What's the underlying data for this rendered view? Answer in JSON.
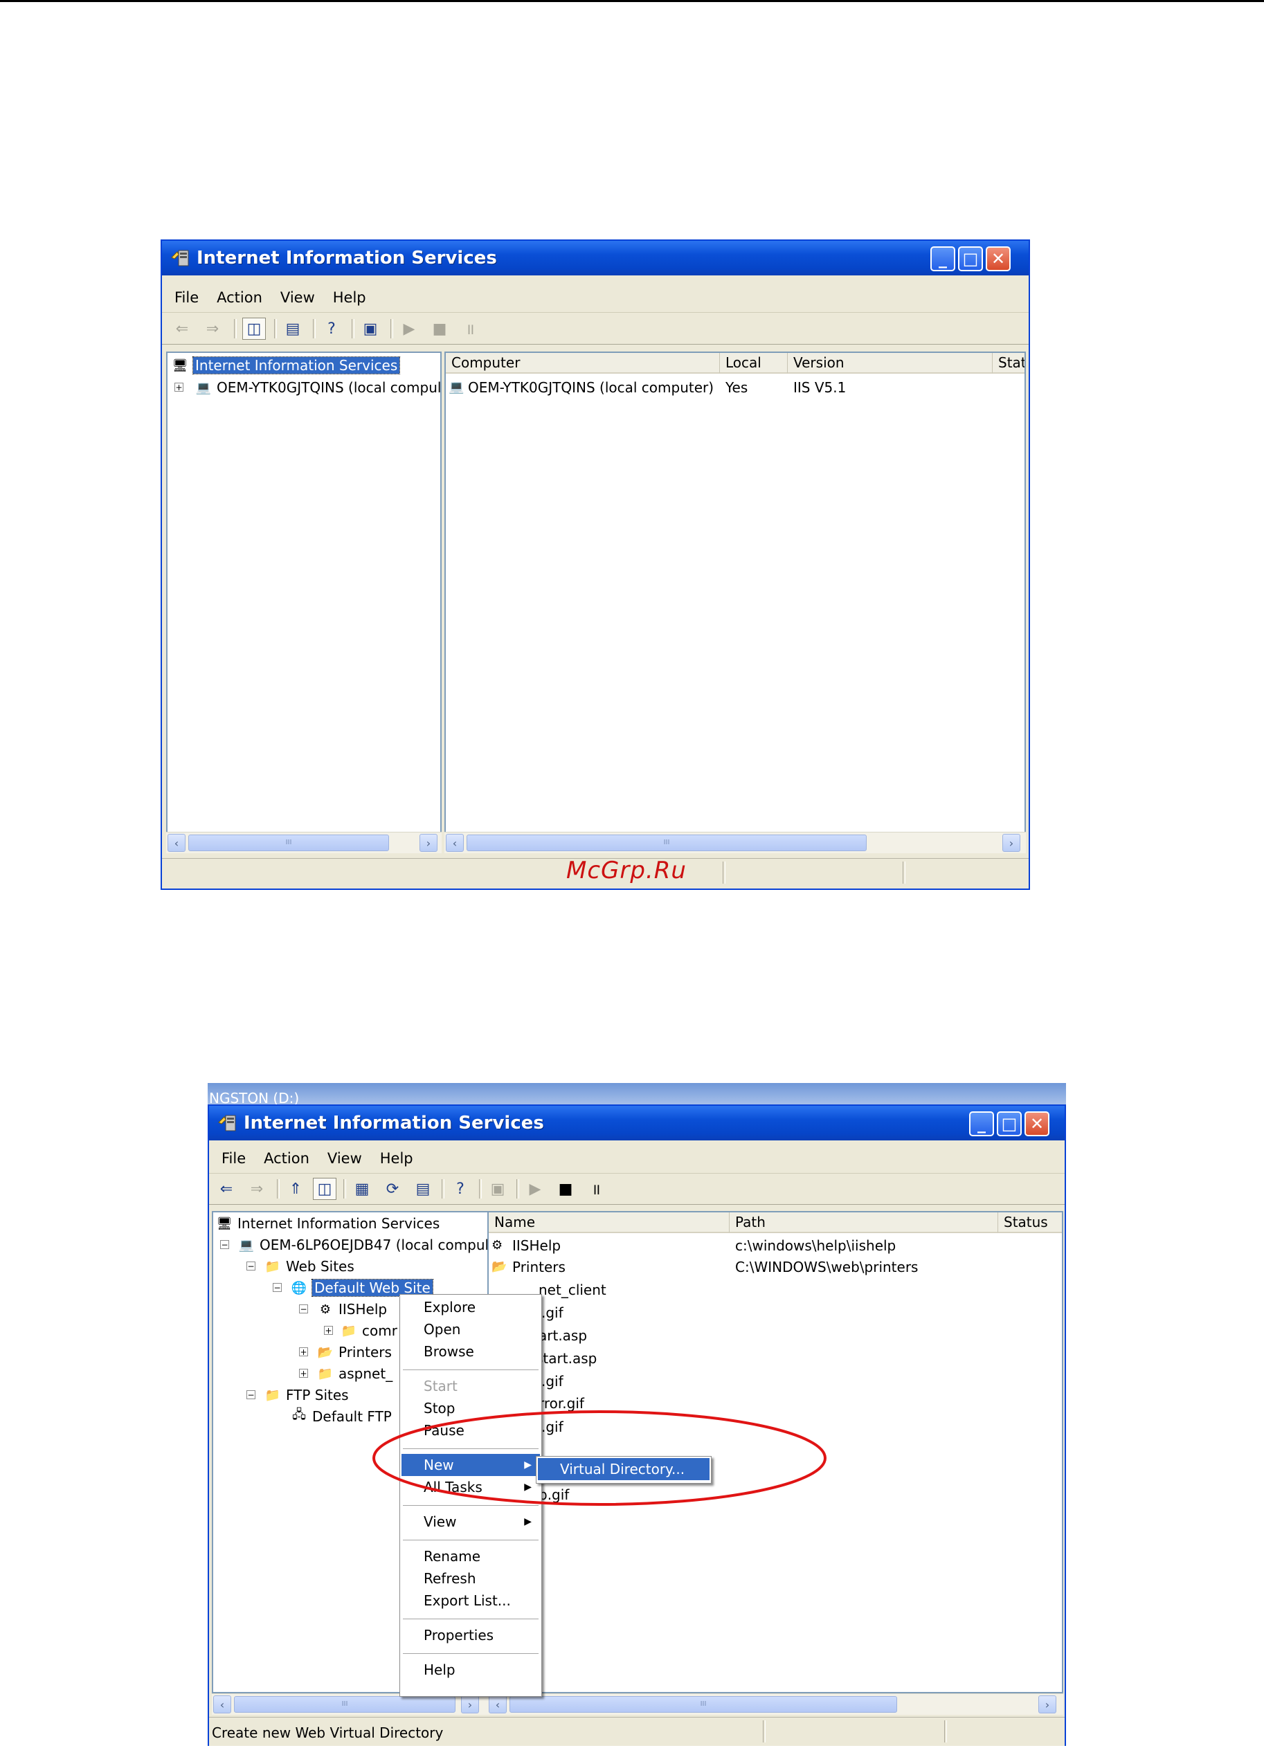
{
  "watermark": "McGrp.Ru",
  "window1": {
    "title": "Internet Information Services",
    "menu": [
      "File",
      "Action",
      "View",
      "Help"
    ],
    "tree": {
      "root": "Internet Information Services",
      "computer": "OEM-YTK0GJTQINS (local compul"
    },
    "columns": [
      "Computer",
      "Local",
      "Version",
      "Stat"
    ],
    "row": {
      "computer": "OEM-YTK0GJTQINS (local computer)",
      "local": "Yes",
      "version": "IIS V5.1"
    },
    "scroll_grip": "III"
  },
  "window2": {
    "strip_text": "NGSTON (D:)",
    "title": "Internet Information Services",
    "menu": [
      "File",
      "Action",
      "View",
      "Help"
    ],
    "tree": {
      "root": "Internet Information Services",
      "computer": "OEM-6LP6OEJDB47 (local compul",
      "web_sites": "Web Sites",
      "default_web_site": "Default Web Site",
      "iishelp": "IISHelp",
      "common": "comr",
      "printers": "Printers",
      "aspnet": "aspnet_",
      "ftp_sites": "FTP Sites",
      "default_ftp": "Default FTP"
    },
    "columns": [
      "Name",
      "Path",
      "Status"
    ],
    "rows": [
      {
        "name": "IISHelp",
        "path": "c:\\windows\\help\\iishelp"
      },
      {
        "name": "Printers",
        "path": "C:\\WINDOWS\\web\\printers"
      },
      {
        "name": "net_client",
        "path": ""
      },
      {
        "name": ".gif",
        "path": ""
      },
      {
        "name": "art.asp",
        "path": ""
      },
      {
        "name": "start.asp",
        "path": ""
      },
      {
        "name": ".gif",
        "path": ""
      },
      {
        "name": "rror.gif",
        "path": ""
      },
      {
        "name": ".gif",
        "path": ""
      },
      {
        "name": "p.gif",
        "path": ""
      }
    ],
    "context_menu": {
      "explore": "Explore",
      "open": "Open",
      "browse": "Browse",
      "start": "Start",
      "stop": "Stop",
      "pause": "Pause",
      "new": "New",
      "all_tasks": "All Tasks",
      "view": "View",
      "rename": "Rename",
      "refresh": "Refresh",
      "export_list": "Export List...",
      "properties": "Properties",
      "help": "Help"
    },
    "submenu": {
      "virtual_directory": "Virtual Directory..."
    },
    "status_text": "Create new Web Virtual Directory",
    "scroll_grip": "III"
  }
}
